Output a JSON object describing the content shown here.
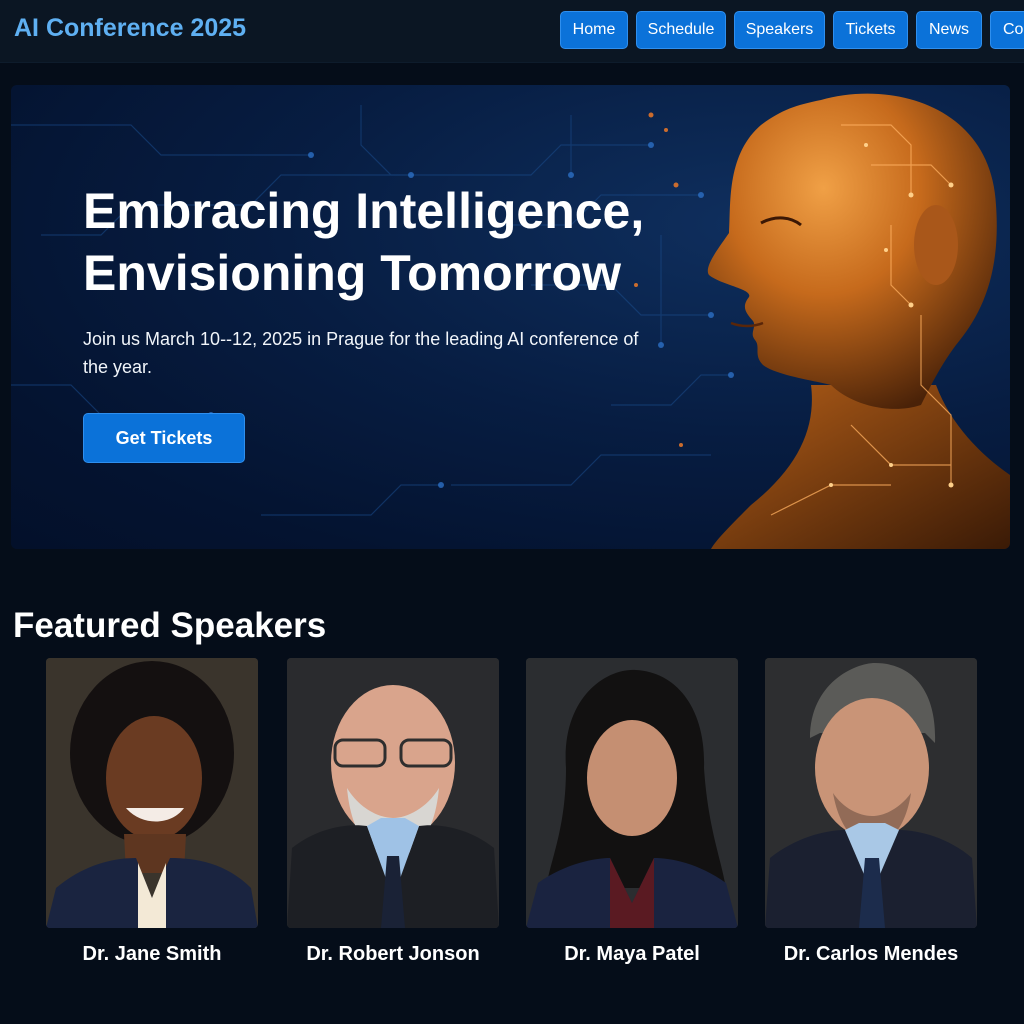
{
  "header": {
    "brand": "AI Conference 2025",
    "nav": [
      {
        "label": "Home"
      },
      {
        "label": "Schedule"
      },
      {
        "label": "Speakers"
      },
      {
        "label": "Tickets"
      },
      {
        "label": "News"
      },
      {
        "label": "Co"
      }
    ]
  },
  "hero": {
    "title_line1": "Embracing Intelligence,",
    "title_line2": "Envisioning Tomorrow",
    "subtitle": "Join us March 10--12, 2025 in Prague for the leading AI conference of the year.",
    "cta_label": "Get Tickets"
  },
  "speakers_section": {
    "title": "Featured Speakers",
    "speakers": [
      {
        "name": "Dr. Jane Smith"
      },
      {
        "name": "Dr. Robert Jonson"
      },
      {
        "name": "Dr. Maya Patel"
      },
      {
        "name": "Dr. Carlos Mendes"
      }
    ]
  },
  "colors": {
    "background": "#050d19",
    "header": "#0b1623",
    "brand": "#5fb0f2",
    "accent_button": "#0b72d9",
    "hero_bg": "#071d42",
    "ai_head": "#d07a24"
  }
}
